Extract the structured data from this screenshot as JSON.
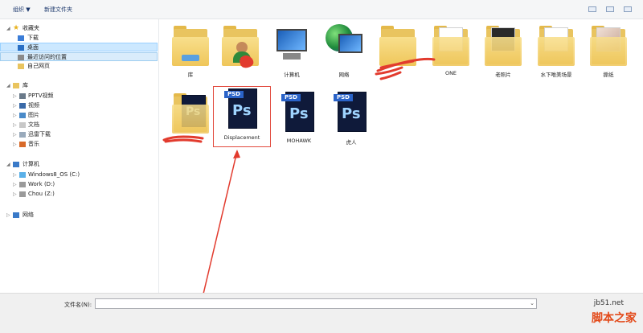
{
  "toolbar": {
    "organize_label": "组织 ▼",
    "new_folder_label": "新建文件夹"
  },
  "nav": {
    "favorites": {
      "label": "收藏夹",
      "items": [
        "下载",
        "桌面",
        "最近访问的位置",
        "自己网页"
      ]
    },
    "library": {
      "label": "库",
      "items": [
        "PPTV视频",
        "视频",
        "图片",
        "文档",
        "迅雷下载",
        "音乐"
      ]
    },
    "computer": {
      "label": "计算机",
      "items": [
        "Windows8_OS (C:)",
        "Work (D:)",
        "Chou (Z:)"
      ]
    },
    "network": {
      "label": "网络"
    }
  },
  "items": [
    {
      "label": "库",
      "icon": "library-folder-icon"
    },
    {
      "label": "",
      "icon": "user-folder-icon"
    },
    {
      "label": "计算机",
      "icon": "computer-icon"
    },
    {
      "label": "网络",
      "icon": "network-icon"
    },
    {
      "label": "",
      "icon": "folder-icon"
    },
    {
      "label": "ONE",
      "icon": "folder-icon"
    },
    {
      "label": "老照片",
      "icon": "folder-icon"
    },
    {
      "label": "水下唯美场景",
      "icon": "folder-icon"
    },
    {
      "label": "撕纸",
      "icon": "folder-icon"
    },
    {
      "label": "",
      "icon": "psd-folder-icon"
    },
    {
      "label": "Displacement",
      "icon": "psd-file-icon"
    },
    {
      "label": "MOHAWK",
      "icon": "psd-file-icon"
    },
    {
      "label": "虎人",
      "icon": "psd-file-icon"
    }
  ],
  "psd": {
    "tag": "PSD",
    "ps": "Ps"
  },
  "bottom": {
    "filename_label": "文件名(N):",
    "filename_value": "",
    "dropdown": "⌄"
  },
  "watermark": {
    "url": "jb51.net",
    "brand": "脚本之家"
  },
  "colors": {
    "selection": "#cce8ff",
    "annotation": "#e23b2e",
    "psd_blue": "#2a63c8"
  }
}
